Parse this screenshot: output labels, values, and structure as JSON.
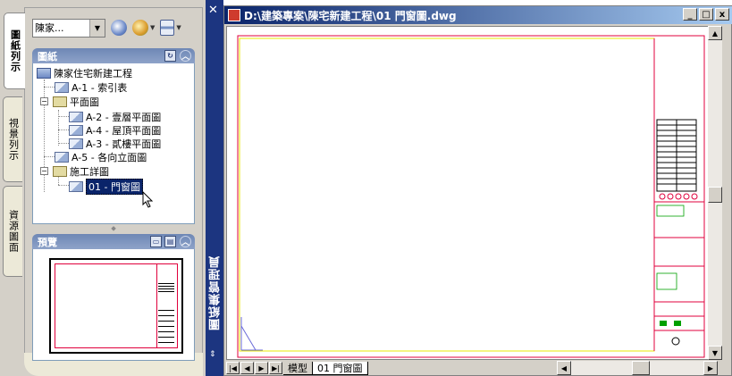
{
  "palette": {
    "tabs": [
      {
        "label": "圖紙列示",
        "active": true
      },
      {
        "label": "視景列示",
        "active": false
      },
      {
        "label": "資源圖面",
        "active": false
      }
    ],
    "combo_value": "陳家...",
    "sheets_header": "圖紙",
    "preview_header": "預覽",
    "vertical_title": "圖紙集管理員",
    "tree": [
      {
        "label": "陳家住宅新建工程",
        "type": "root"
      },
      {
        "label": "A-1 - 索引表",
        "type": "sheet"
      },
      {
        "label": "平面圖",
        "type": "folder"
      },
      {
        "label": "A-2 - 壹層平面圖",
        "type": "sheet"
      },
      {
        "label": "A-4 - 屋頂平面圖",
        "type": "sheet"
      },
      {
        "label": "A-3 - 貳樓平面圖",
        "type": "sheet"
      },
      {
        "label": "A-5 - 各向立面圖",
        "type": "sheet"
      },
      {
        "label": "施工詳圖",
        "type": "folder"
      },
      {
        "label": "01 - 門窗圖",
        "type": "sheet",
        "selected": true
      }
    ]
  },
  "drawing": {
    "title": "D:\\建築專案\\陳宅新建工程\\01 門窗圖.dwg",
    "window_buttons": [
      "_",
      "□",
      "x"
    ],
    "layout_tabs": [
      {
        "label": "模型",
        "active": false
      },
      {
        "label": "01 門窗圖",
        "active": true
      }
    ]
  },
  "colors": {
    "panel_bg": "#d4d0c8",
    "palette_bar": "#1c3580",
    "selection": "#0a246a",
    "border_red": "#e0003c",
    "border_yellow": "#e8e800"
  }
}
